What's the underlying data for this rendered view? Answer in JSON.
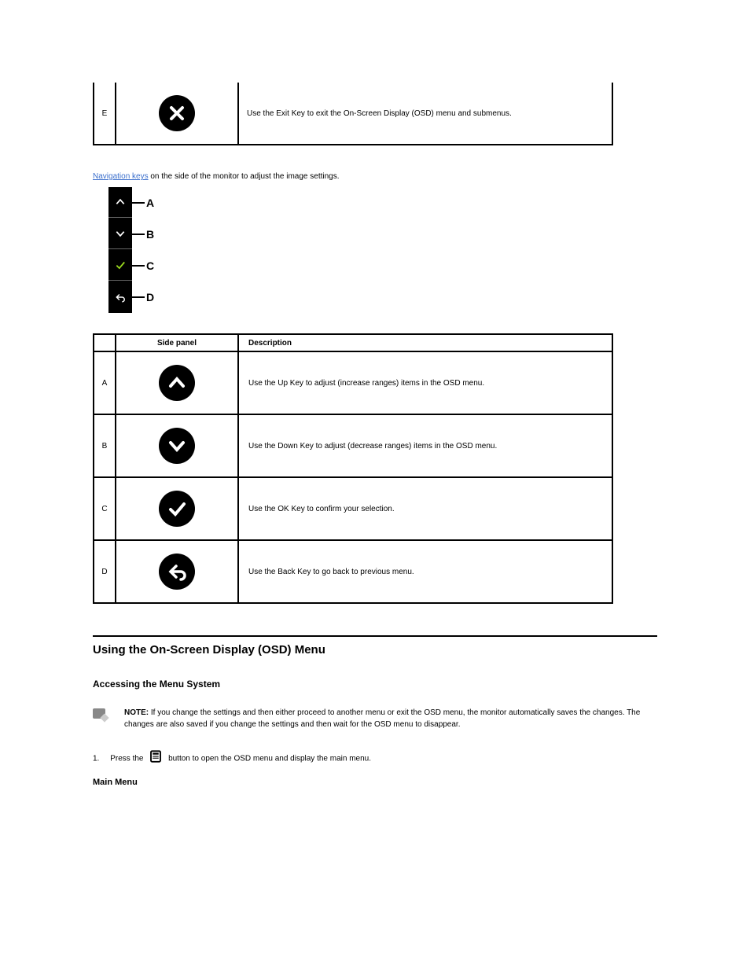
{
  "top_row": {
    "letter": "E",
    "desc": "Use the Exit Key to exit the On-Screen Display (OSD) menu and submenus."
  },
  "navkeys_note_prefix": "Navigation keys",
  "navkeys_note_rest": " on the side of the monitor to adjust the image settings.",
  "osd_labels": {
    "a": "A",
    "b": "B",
    "c": "C",
    "d": "D"
  },
  "nav_table": {
    "head_panel": "Side panel",
    "head_desc": "Description",
    "rows": [
      {
        "letter": "A",
        "desc": "Use the Up Key to adjust (increase ranges) items in the OSD menu."
      },
      {
        "letter": "B",
        "desc": "Use the Down Key to adjust (decrease ranges) items in the OSD menu."
      },
      {
        "letter": "C",
        "desc": "Use the OK Key to confirm your selection."
      },
      {
        "letter": "D",
        "desc": "Use the Back Key to go back to previous menu."
      }
    ]
  },
  "section_title": "Using the On-Screen Display (OSD) Menu",
  "sub_title": "Accessing the Menu System",
  "note_label": "NOTE:",
  "note_body": "If you change the settings and then either proceed to another menu or exit the OSD menu, the monitor automatically saves the changes. The changes are also saved if you change the settings and then wait for the OSD menu to disappear.",
  "step1_num": "1.",
  "step1_before": "Press the",
  "step1_after": "button to open the OSD menu and display the main menu.",
  "main_caption": "Main Menu"
}
